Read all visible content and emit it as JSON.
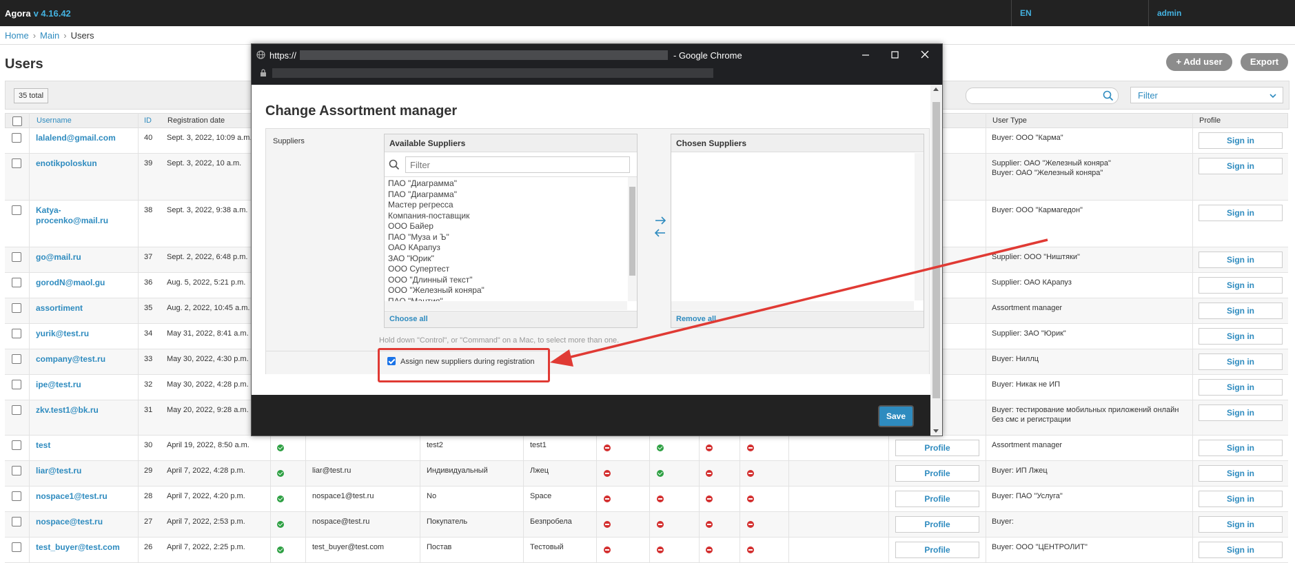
{
  "header": {
    "brand": "Agora",
    "version": "v 4.16.42",
    "lang": "EN",
    "user": "admin"
  },
  "breadcrumb": {
    "home": "Home",
    "main": "Main",
    "current": "Users"
  },
  "page": {
    "title": "Users",
    "add_user": "Add user",
    "export": "Export",
    "total": "35 total",
    "filter": "Filter"
  },
  "columns": {
    "username": "Username",
    "id": "ID",
    "registration_date": "Registration date",
    "user_type": "User Type",
    "profile": "Profile"
  },
  "labels": {
    "profile": "Profile",
    "sign_in": "Sign in"
  },
  "rows": [
    {
      "username": "lalalend@gmail.com",
      "id": "40",
      "date": "Sept. 3, 2022, 10:09 a.m.",
      "type1": "Buyer: ООО \"Карма\"",
      "type2": ""
    },
    {
      "username": "enotikpoloskun",
      "id": "39",
      "date": "Sept. 3, 2022, 10 a.m.",
      "type1": "Supplier: ОАО \"Железный коняра\"",
      "type2": "Buyer: ОАО \"Железный коняра\""
    },
    {
      "username": "Katya-procenko@mail.ru",
      "id": "38",
      "date": "Sept. 3, 2022, 9:38 a.m.",
      "type1": "Buyer: ООО \"Кармагедон\"",
      "type2": ""
    },
    {
      "username": "go@mail.ru",
      "id": "37",
      "date": "Sept. 2, 2022, 6:48 p.m.",
      "type1": "Supplier: ООО \"Ништяки\"",
      "type2": ""
    },
    {
      "username": "gorodN@maol.gu",
      "id": "36",
      "date": "Aug. 5, 2022, 5:21 p.m.",
      "type1": "Supplier: ОАО КАрапуз",
      "type2": ""
    },
    {
      "username": "assortiment",
      "id": "35",
      "date": "Aug. 2, 2022, 10:45 a.m.",
      "type1": "Assortment manager",
      "type2": ""
    },
    {
      "username": "yurik@test.ru",
      "id": "34",
      "date": "May 31, 2022, 8:41 a.m.",
      "type1": "Supplier: ЗАО \"Юрик\"",
      "type2": ""
    },
    {
      "username": "company@test.ru",
      "id": "33",
      "date": "May 30, 2022, 4:30 p.m.",
      "type1": "Buyer: Ниллц",
      "type2": ""
    },
    {
      "username": "ipe@test.ru",
      "id": "32",
      "date": "May 30, 2022, 4:28 p.m.",
      "type1": "Buyer: Никак не ИП",
      "type2": ""
    },
    {
      "username": "zkv.test1@bk.ru",
      "id": "31",
      "date": "May 20, 2022, 9:28 a.m.",
      "type1": "Buyer: тестирование мобильных приложений онлайн",
      "type2": "без смс и регистрации"
    },
    {
      "username": "test",
      "id": "30",
      "date": "April 19, 2022, 8:50 a.m.",
      "email": "",
      "c1": "test2",
      "c2": "test1",
      "type1": "Assortment manager",
      "type2": ""
    },
    {
      "username": "liar@test.ru",
      "id": "29",
      "date": "April 7, 2022, 4:28 p.m.",
      "email": "liar@test.ru",
      "c1": "Индивидуальный",
      "c2": "Лжец",
      "type1": "Buyer: ИП Лжец",
      "type2": ""
    },
    {
      "username": "nospace1@test.ru",
      "id": "28",
      "date": "April 7, 2022, 4:20 p.m.",
      "email": "nospace1@test.ru",
      "c1": "No",
      "c2": "Space",
      "type1": "Buyer: ПАО \"Услуга\"",
      "type2": ""
    },
    {
      "username": "nospace@test.ru",
      "id": "27",
      "date": "April 7, 2022, 2:53 p.m.",
      "email": "nospace@test.ru",
      "c1": "Покупатель",
      "c2": "Безпробела",
      "type1": "Buyer:",
      "type2": ""
    },
    {
      "username": "test_buyer@test.com",
      "id": "26",
      "date": "April 7, 2022, 2:25 p.m.",
      "email": "test_buyer@test.com",
      "c1": "Постав",
      "c2": "Тестовый",
      "type1": "Buyer: ООО \"ЦЕНТРОЛИТ\"",
      "type2": ""
    }
  ],
  "modal": {
    "url_prefix": "https://",
    "app": "- Google Chrome",
    "title": "Change Assortment manager",
    "suppliers_label": "Suppliers",
    "available_title": "Available Suppliers",
    "chosen_title": "Chosen Suppliers",
    "filter_placeholder": "Filter",
    "options": [
      "ПАО \"Диаграмма\"",
      "ПАО \"Диаграмма\"",
      "Мастер регресса",
      "Компания-поставщик",
      "ООО Байер",
      "ПАО \"Муза и Ъ\"",
      "ОАО КАрапуз",
      "ЗАО \"Юрик\"",
      "ООО Супертест",
      "ООО \"Длинный текст\"",
      "ООО \"Железный коняра\"",
      "ПАО \"Мантия\""
    ],
    "choose_all": "Choose all",
    "remove_all": "Remove all",
    "help": "Hold down \"Control\", or \"Command\" on a Mac, to select more than one.",
    "assign_label": "Assign new suppliers during registration",
    "save": "Save"
  },
  "colors": {
    "accent": "#2e8bbf",
    "annotation": "#e03a34"
  }
}
